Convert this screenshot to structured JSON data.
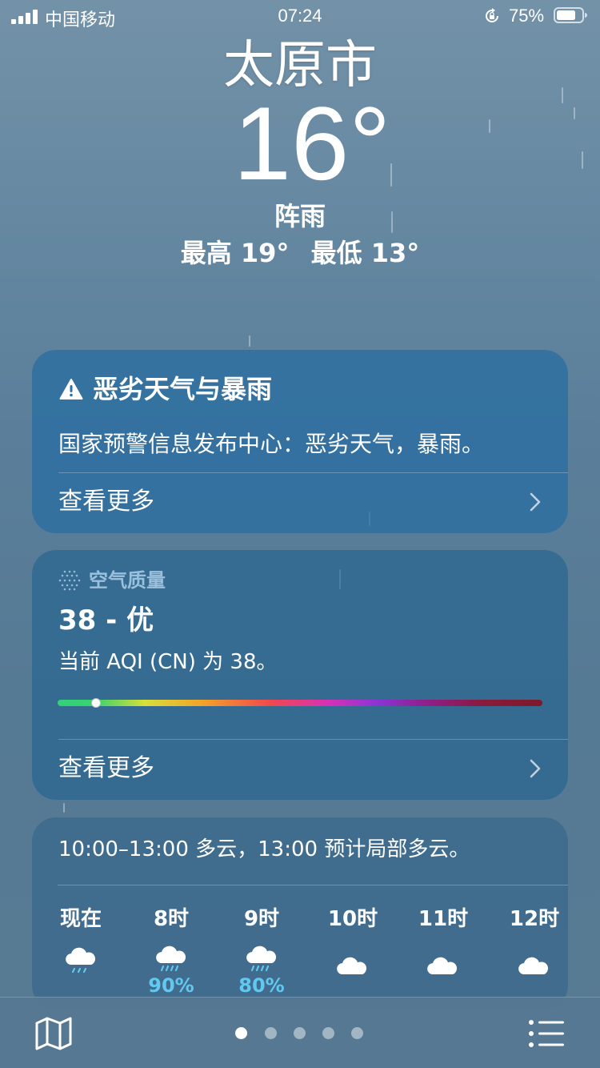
{
  "status_bar": {
    "carrier": "中国移动",
    "time": "07:24",
    "battery": "75%"
  },
  "header": {
    "city": "太原市",
    "temperature": "16°",
    "condition": "阵雨",
    "high": "最高 19°",
    "low": "最低 13°"
  },
  "alert_card": {
    "title": "恶劣天气与暴雨",
    "text": "国家预警信息发布中心：恶劣天气，暴雨。",
    "more_label": "查看更多",
    "icon": "warning-triangle-icon"
  },
  "aqi_card": {
    "header": "空气质量",
    "value": "38 - 优",
    "description": "当前 AQI (CN) 为 38。",
    "more_label": "查看更多",
    "aqi_level_fraction": 0.08,
    "icon": "air-quality-dots-icon"
  },
  "hourly_card": {
    "summary": "10:00–13:00 多云，13:00 预计局部多云。",
    "hours": [
      {
        "label": "现在",
        "icon": "cloud-rain-icon",
        "pop": ""
      },
      {
        "label": "8时",
        "icon": "cloud-heavy-rain-icon",
        "pop": "90%"
      },
      {
        "label": "9时",
        "icon": "cloud-heavy-rain-icon",
        "pop": "80%"
      },
      {
        "label": "10时",
        "icon": "cloud-icon",
        "pop": ""
      },
      {
        "label": "11时",
        "icon": "cloud-icon",
        "pop": ""
      },
      {
        "label": "12时",
        "icon": "cloud-icon",
        "pop": ""
      }
    ]
  },
  "bottom_bar": {
    "page_count": 5,
    "active_page": 0,
    "left_icon": "map-icon",
    "right_icon": "list-icon"
  },
  "colors": {
    "precip_text": "#61c8f0",
    "alert_card_bg": "#266ca2",
    "background": "#5b7f9a"
  }
}
